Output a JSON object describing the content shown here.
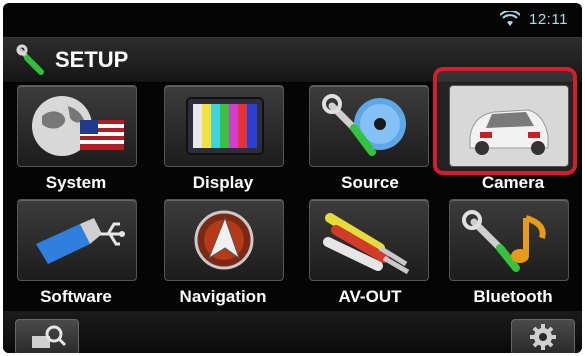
{
  "status": {
    "time": "12:11",
    "wifi_icon": "wifi-icon"
  },
  "header": {
    "title": "SETUP",
    "icon": "wrench-icon"
  },
  "tiles": [
    {
      "label": "System",
      "icon": "globe-flag-icon"
    },
    {
      "label": "Display",
      "icon": "color-bars-tv-icon"
    },
    {
      "label": "Source",
      "icon": "disc-wrench-icon"
    },
    {
      "label": "Camera",
      "icon": "car-rear-camera-icon",
      "selected": true
    },
    {
      "label": "Software",
      "icon": "usb-drive-icon"
    },
    {
      "label": "Navigation",
      "icon": "compass-arrow-icon"
    },
    {
      "label": "AV-OUT",
      "icon": "rca-cables-icon"
    },
    {
      "label": "Bluetooth",
      "icon": "bluetooth-music-icon"
    }
  ],
  "bottom": {
    "left_icon": "search-zoom-icon",
    "right_icon": "gear-icon"
  },
  "colors": {
    "highlight": "#d21f2b",
    "clock": "#a9ddeb",
    "background": "#050505"
  }
}
